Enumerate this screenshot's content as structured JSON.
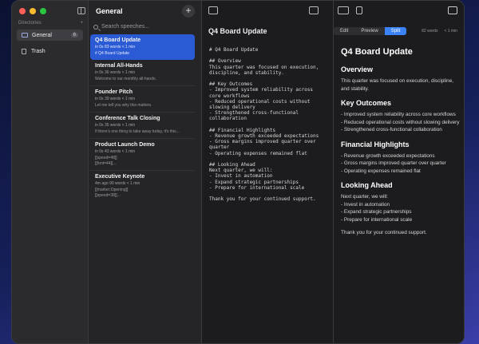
{
  "sidebar": {
    "header": "Directories",
    "add": "+",
    "items": [
      {
        "label": "General",
        "count": "6"
      },
      {
        "label": "Trash"
      }
    ]
  },
  "list": {
    "title": "General",
    "add": "+",
    "search_placeholder": "Search speeches...",
    "speeches": [
      {
        "title": "Q4 Board Update",
        "meta": "in 0s   83 words   < 1 min",
        "preview": "# Q4 Board Update"
      },
      {
        "title": "Internal All-Hands",
        "meta": "in 0s   36 words   < 1 min",
        "preview": "Welcome to our monthly all-hands."
      },
      {
        "title": "Founder Pitch",
        "meta": "in 0s   39 words   < 1 min",
        "preview": "Let me tell you why this matters."
      },
      {
        "title": "Conference Talk Closing",
        "meta": "in 0s   35 words   < 1 min",
        "preview": "If there's one thing to take away today, it's this..."
      },
      {
        "title": "Product Launch Demo",
        "meta": "in 0s   43 words   < 1 min",
        "preview": "[[speed=48]]\n[[font=44]]..."
      },
      {
        "title": "Executive Keynote",
        "meta": "4m ago   90 words   < 1 min",
        "preview": "[[marker:Opening]]\n[[speed=38]]..."
      }
    ]
  },
  "editor": {
    "title": "Q4 Board Update",
    "source": "# Q4 Board Update\n\n## Overview\nThis quarter was focused on execution,\ndiscipline, and stability.\n\n## Key Outcomes\n- Improved system reliability across\ncore workflows\n- Reduced operational costs without\nslowing delivery\n- Strengthened cross-functional\ncollaboration\n\n## Financial Highlights\n- Revenue growth exceeded expectations\n- Gross margins improved quarter over\nquarter\n- Operating expenses remained flat\n\n## Looking Ahead\nNext quarter, we will:\n- Invest in automation\n- Expand strategic partnerships\n- Prepare for international scale\n\nThank you for your continued support."
  },
  "modes": {
    "edit": "Edit",
    "preview": "Preview",
    "split": "Split",
    "active": "Split"
  },
  "stats": {
    "words": "82 words",
    "time": "< 1 min"
  },
  "preview": {
    "h1": "Q4 Board Update",
    "overview_h": "Overview",
    "overview_p": "This quarter was focused on execution, discipline, and stability.",
    "outcomes_h": "Key Outcomes",
    "outcomes": [
      "- Improved system reliability across core workflows",
      "- Reduced operational costs without slowing delivery",
      "- Strengthened cross-functional collaboration"
    ],
    "fin_h": "Financial Highlights",
    "fin": [
      "- Revenue growth exceeded expectations",
      "- Gross margins improved quarter over quarter",
      "- Operating expenses remained flat"
    ],
    "ahead_h": "Looking Ahead",
    "ahead_intro": "Next quarter, we will:",
    "ahead": [
      "- Invest in automation",
      "- Expand strategic partnerships",
      "- Prepare for international scale"
    ],
    "closing": "Thank you for your continued support."
  },
  "colors": {
    "accent": "#2b5bd4",
    "split_active": "#3b82f6"
  }
}
